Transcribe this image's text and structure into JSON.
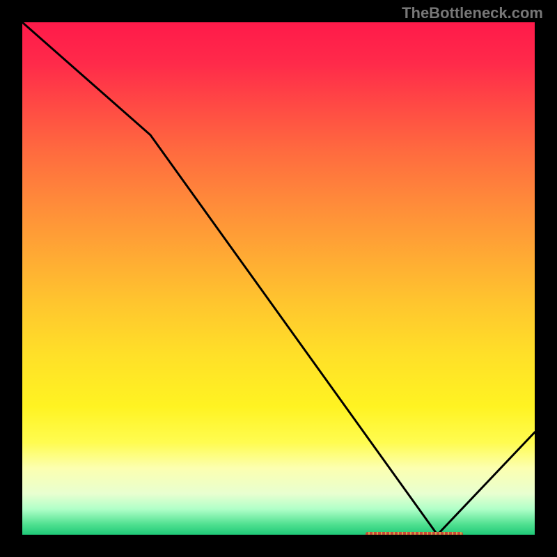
{
  "watermark": "TheBottleneck.com",
  "chart_data": {
    "type": "line",
    "title": "",
    "xlabel": "",
    "ylabel": "",
    "xlim": [
      0,
      100
    ],
    "ylim": [
      0,
      100
    ],
    "x": [
      0,
      25,
      81,
      100
    ],
    "values": [
      100,
      78,
      0,
      20
    ],
    "marker_band": {
      "x_start": 67,
      "x_end": 86,
      "y": 0
    },
    "background_gradient": {
      "type": "vertical",
      "top_color": "#ff1a4a",
      "mid_color": "#ffe028",
      "bottom_color": "#1fc978"
    }
  }
}
